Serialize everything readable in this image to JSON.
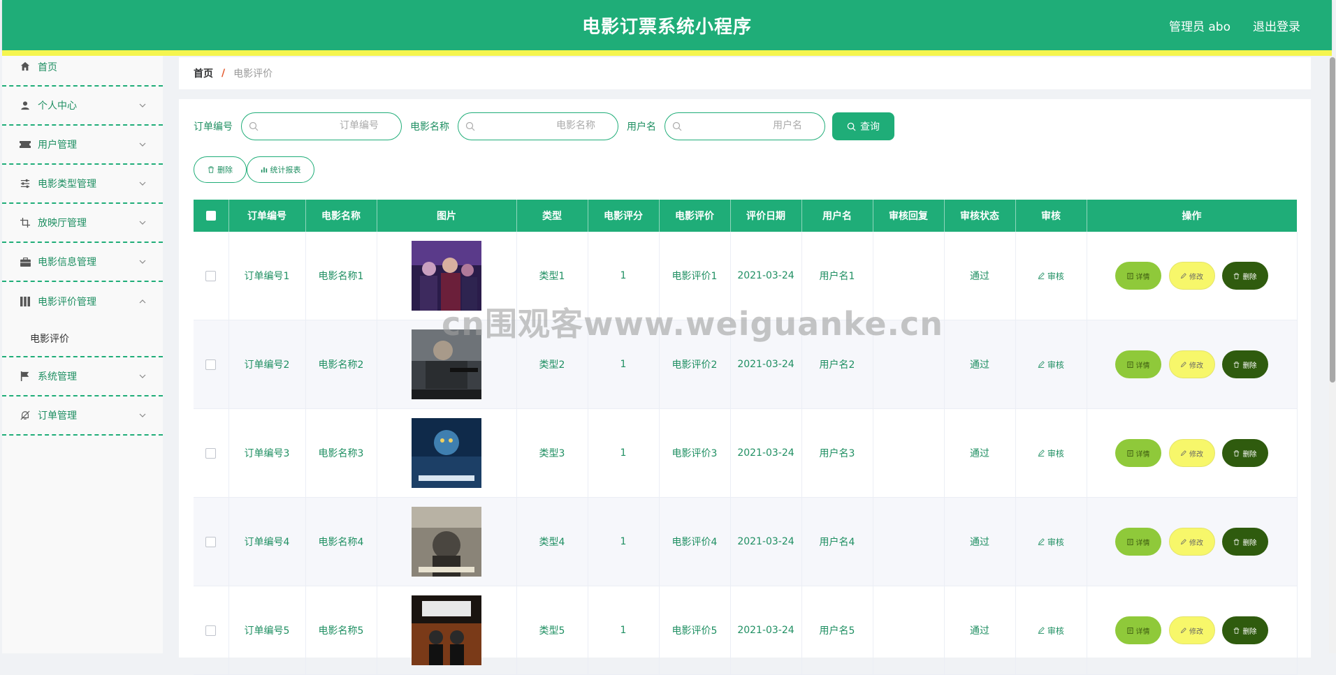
{
  "header": {
    "title": "电影订票系统小程序",
    "user_label": "管理员 abo",
    "logout_label": "退出登录"
  },
  "sidebar": {
    "items": [
      {
        "label": "首页",
        "icon": "home-icon"
      },
      {
        "label": "个人中心",
        "icon": "user-icon"
      },
      {
        "label": "用户管理",
        "icon": "ticket-icon"
      },
      {
        "label": "电影类型管理",
        "icon": "sliders-icon"
      },
      {
        "label": "放映厅管理",
        "icon": "crop-icon"
      },
      {
        "label": "电影信息管理",
        "icon": "briefcase-icon"
      },
      {
        "label": "电影评价管理",
        "icon": "film-icon"
      },
      {
        "label": "系统管理",
        "icon": "flag-icon"
      },
      {
        "label": "订单管理",
        "icon": "bell-off-icon"
      }
    ],
    "sub_item": "电影评价"
  },
  "breadcrumb": {
    "home": "首页",
    "separator": "/",
    "current": "电影评价"
  },
  "search": {
    "order_label": "订单编号",
    "order_placeholder": "订单编号",
    "movie_label": "电影名称",
    "movie_placeholder": "电影名称",
    "user_label": "用户名",
    "user_placeholder": "用户名",
    "query_label": "查询"
  },
  "actions": {
    "delete_label": "删除",
    "report_label": "统计报表"
  },
  "table": {
    "headers": [
      "订单编号",
      "电影名称",
      "图片",
      "类型",
      "电影评分",
      "电影评价",
      "评价日期",
      "用户名",
      "审核回复",
      "审核状态",
      "审核",
      "操作"
    ],
    "audit_label": "审核",
    "detail_label": "详情",
    "edit_label": "修改",
    "delete_label": "删除",
    "rows": [
      {
        "order": "订单编号1",
        "movie": "电影名称1",
        "type": "类型1",
        "score": "1",
        "review": "电影评价1",
        "date": "2021-03-24",
        "user": "用户名1",
        "reply": "",
        "status": "通过"
      },
      {
        "order": "订单编号2",
        "movie": "电影名称2",
        "type": "类型2",
        "score": "1",
        "review": "电影评价2",
        "date": "2021-03-24",
        "user": "用户名2",
        "reply": "",
        "status": "通过"
      },
      {
        "order": "订单编号3",
        "movie": "电影名称3",
        "type": "类型3",
        "score": "1",
        "review": "电影评价3",
        "date": "2021-03-24",
        "user": "用户名3",
        "reply": "",
        "status": "通过"
      },
      {
        "order": "订单编号4",
        "movie": "电影名称4",
        "type": "类型4",
        "score": "1",
        "review": "电影评价4",
        "date": "2021-03-24",
        "user": "用户名4",
        "reply": "",
        "status": "通过"
      },
      {
        "order": "订单编号5",
        "movie": "电影名称5",
        "type": "类型5",
        "score": "1",
        "review": "电影评价5",
        "date": "2021-03-24",
        "user": "用户名5",
        "reply": "",
        "status": "通过"
      }
    ]
  },
  "watermark": "cn围观客www.weiguanke.cn",
  "colors": {
    "primary": "#1fad78",
    "accent_yellow": "#f5f54f",
    "detail_btn": "#8fc93a",
    "edit_btn": "#f7f76a",
    "delete_btn": "#2f5b0e"
  }
}
